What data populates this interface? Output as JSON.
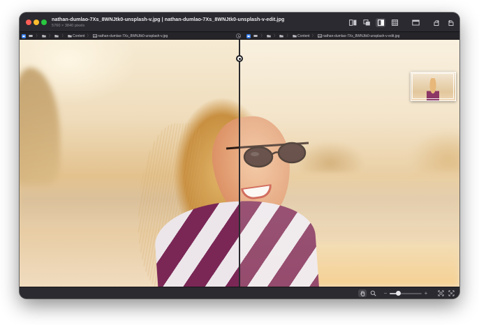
{
  "window": {
    "title": "nathan-dumlao-7Xs_8WNJtk0-unsplash-v.jpg | nathan-dumlao-7Xs_8WNJtk0-unsplash-v-edit.jpg",
    "subtitle": "5760 × 3840 pixels"
  },
  "toolbar": {
    "buttons": [
      {
        "name": "side-by-side-icon",
        "active": false
      },
      {
        "name": "overlay-icon",
        "active": false
      },
      {
        "name": "split-compare-icon",
        "active": true
      },
      {
        "name": "difference-icon",
        "active": false
      },
      {
        "name": "sidebar-icon",
        "active": false
      },
      {
        "name": "rotate-left-icon",
        "active": false
      },
      {
        "name": "rotate-right-icon",
        "active": false
      }
    ]
  },
  "pathbar": {
    "left": {
      "folder": "Content",
      "file": "nathan-dumlao-7Xs_8WNJtk0-unsplash-v.jpg"
    },
    "right": {
      "folder": "Content",
      "file": "nathan-dumlao-7Xs_8WNJtk0-unsplash-v-edit.jpg"
    },
    "separator": "〉"
  },
  "compare": {
    "split_fraction": 0.5
  },
  "bottombar": {
    "zoom_minus": "−",
    "zoom_plus": "+",
    "zoom_fraction": 0.28
  },
  "colors": {
    "accent": "#3b7fe8",
    "close": "#fe5f57",
    "minimize": "#febc2e",
    "maximize": "#28c840"
  }
}
